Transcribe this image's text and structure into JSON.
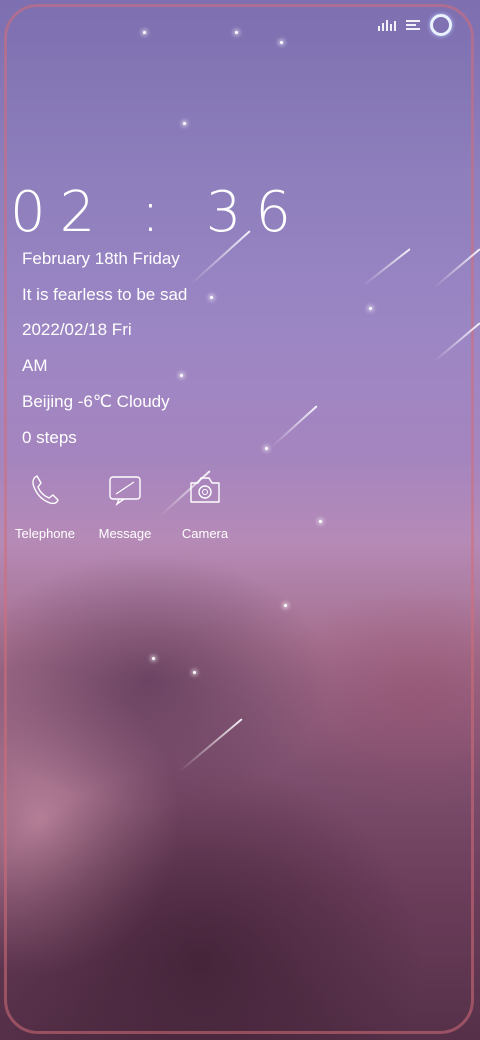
{
  "lockscreen": {
    "time": "02 : 36",
    "date_line": "February   18th  Friday",
    "motto": "It is fearless to be sad",
    "numeric_date": "2022/02/18    Fri",
    "ampm": "AM",
    "weather": "Beijing -6℃ Cloudy",
    "steps": "0  steps"
  },
  "shortcuts": [
    {
      "label": "Telephone",
      "icon": "phone-icon"
    },
    {
      "label": "Message",
      "icon": "message-icon"
    },
    {
      "label": "Camera",
      "icon": "camera-icon"
    }
  ],
  "status_bar": {
    "icons": [
      "signal-icon",
      "list-icon",
      "ring-icon"
    ]
  },
  "colors": {
    "frame": "#d26e78",
    "sky_top": "#7d6fb0",
    "clouds": "#6b3d5a"
  }
}
